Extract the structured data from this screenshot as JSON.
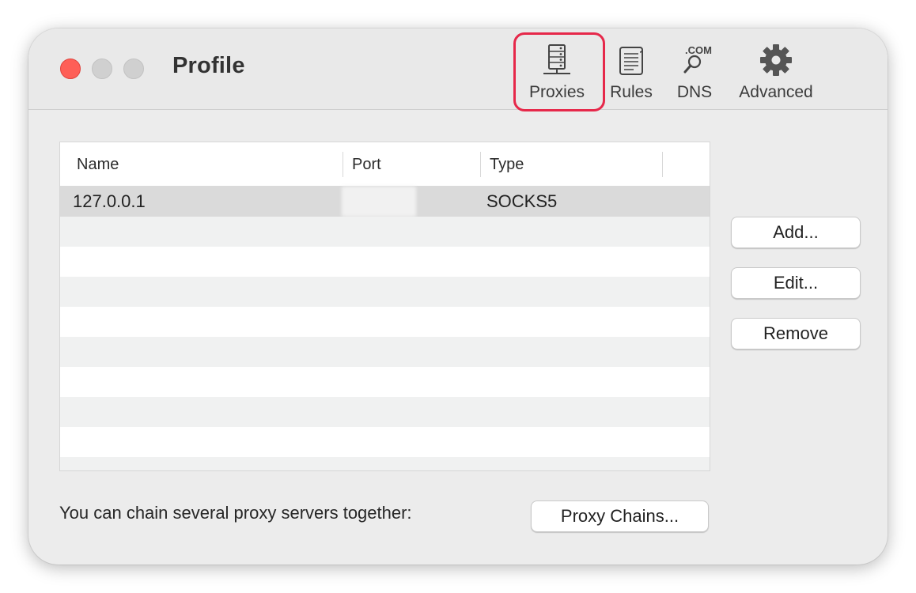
{
  "window": {
    "title": "Profile"
  },
  "toolbar": {
    "items": [
      {
        "label": "Proxies",
        "icon": "server-icon",
        "selected": true
      },
      {
        "label": "Rules",
        "icon": "scroll-icon"
      },
      {
        "label": "DNS",
        "icon": "dns-magnifier-icon",
        "icon_text": ".COM"
      },
      {
        "label": "Advanced",
        "icon": "gear-icon"
      }
    ],
    "highlight_color": "#e6284a"
  },
  "table": {
    "columns": [
      "Name",
      "Port",
      "Type"
    ],
    "rows": [
      {
        "name": "127.0.0.1",
        "port": "",
        "type": "SOCKS5",
        "selected": true
      }
    ]
  },
  "buttons": {
    "add": "Add...",
    "edit": "Edit...",
    "remove": "Remove"
  },
  "footer": {
    "text": "You can chain several proxy servers together:",
    "chains_button": "Proxy Chains..."
  },
  "colors": {
    "close_button": "#fe5f57",
    "window_background": "#ececec",
    "selected_row": "#dadada"
  }
}
